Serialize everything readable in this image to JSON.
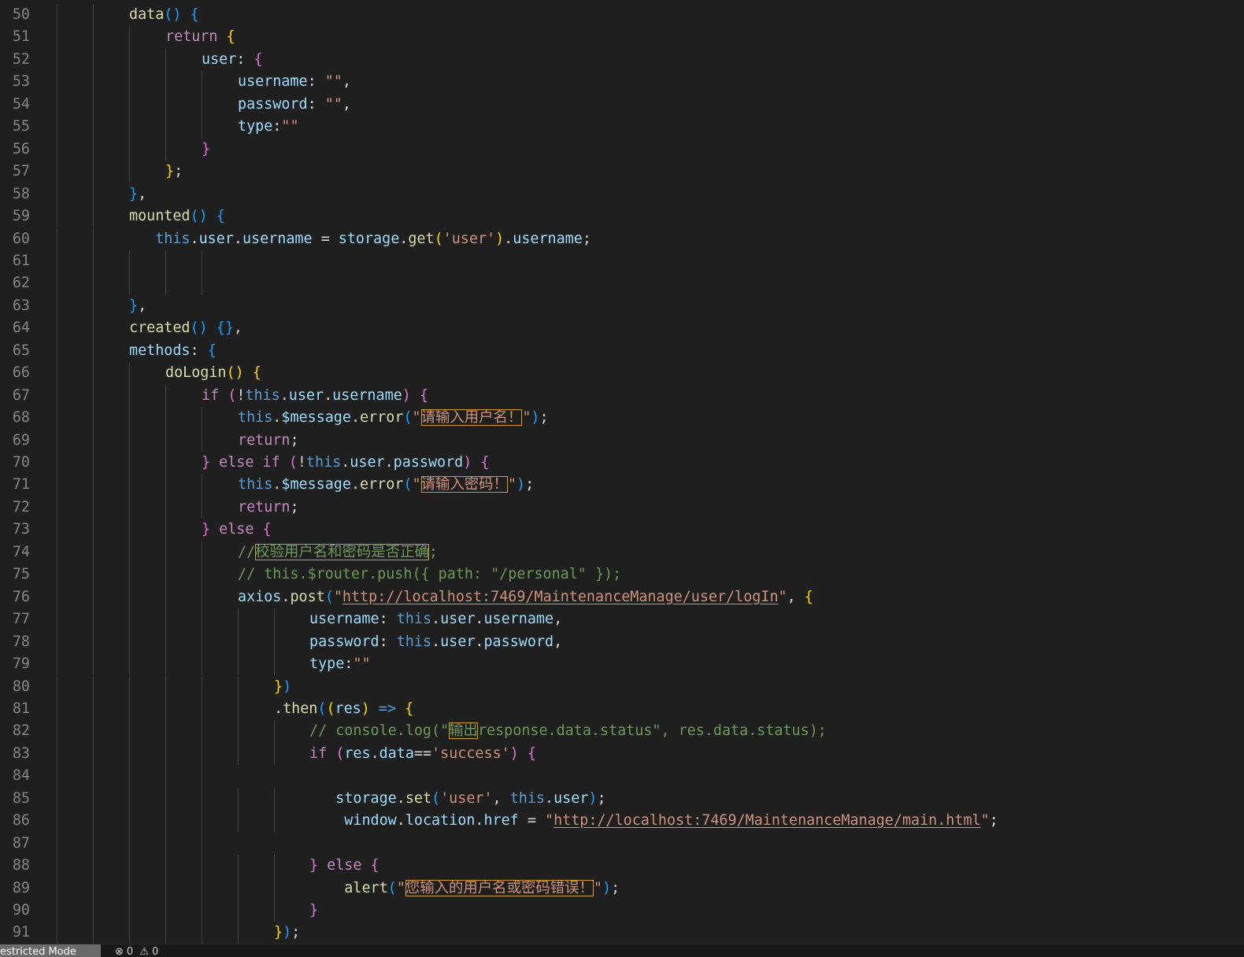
{
  "editor": {
    "lines": [
      {
        "n": "50",
        "indent": 0,
        "tokens": [
          [
            "fn",
            "data"
          ],
          [
            "b3",
            "()"
          ],
          [
            "pu",
            " "
          ],
          [
            "b3",
            "{"
          ]
        ]
      },
      {
        "n": "51",
        "indent": 1,
        "tokens": [
          [
            "kw",
            "return"
          ],
          [
            "pu",
            " "
          ],
          [
            "b1",
            "{"
          ]
        ]
      },
      {
        "n": "52",
        "indent": 2,
        "tokens": [
          [
            "pr",
            "user"
          ],
          [
            "pu",
            ": "
          ],
          [
            "b2",
            "{"
          ]
        ]
      },
      {
        "n": "53",
        "indent": 3,
        "tokens": [
          [
            "pr",
            "username"
          ],
          [
            "pu",
            ": "
          ],
          [
            "st",
            "\"\""
          ],
          [
            "pu",
            ","
          ]
        ]
      },
      {
        "n": "54",
        "indent": 3,
        "tokens": [
          [
            "pr",
            "password"
          ],
          [
            "pu",
            ": "
          ],
          [
            "st",
            "\"\""
          ],
          [
            "pu",
            ","
          ]
        ]
      },
      {
        "n": "55",
        "indent": 3,
        "tokens": [
          [
            "pr",
            "type"
          ],
          [
            "pu",
            ":"
          ],
          [
            "st",
            "\"\""
          ]
        ]
      },
      {
        "n": "56",
        "indent": 2,
        "tokens": [
          [
            "b2",
            "}"
          ]
        ]
      },
      {
        "n": "57",
        "indent": 1,
        "tokens": [
          [
            "b1",
            "}"
          ],
          [
            "pu",
            ";"
          ]
        ]
      },
      {
        "n": "58",
        "indent": 0,
        "tokens": [
          [
            "b3",
            "}"
          ],
          [
            "pu",
            ","
          ]
        ]
      },
      {
        "n": "59",
        "indent": 0,
        "tokens": [
          [
            "fn",
            "mounted"
          ],
          [
            "b3",
            "()"
          ],
          [
            "pu",
            " "
          ],
          [
            "b3",
            "{"
          ]
        ]
      },
      {
        "n": "60",
        "indent": 0,
        "tokens": [
          [
            "pu",
            "   "
          ],
          [
            "k1",
            "this"
          ],
          [
            "pu",
            "."
          ],
          [
            "pr",
            "user"
          ],
          [
            "pu",
            "."
          ],
          [
            "pr",
            "username"
          ],
          [
            "pu",
            " = "
          ],
          [
            "pr",
            "storage"
          ],
          [
            "pu",
            "."
          ],
          [
            "fn",
            "get"
          ],
          [
            "b1",
            "("
          ],
          [
            "st",
            "'user'"
          ],
          [
            "b1",
            ")"
          ],
          [
            "pu",
            "."
          ],
          [
            "pr",
            "username"
          ],
          [
            "pu",
            ";"
          ]
        ]
      },
      {
        "n": "61",
        "indent": 0,
        "tokens": []
      },
      {
        "n": "62",
        "indent": 0,
        "tokens": []
      },
      {
        "n": "63",
        "indent": 0,
        "tokens": [
          [
            "b3",
            "}"
          ],
          [
            "pu",
            ","
          ]
        ]
      },
      {
        "n": "64",
        "indent": 0,
        "tokens": [
          [
            "fn",
            "created"
          ],
          [
            "b3",
            "()"
          ],
          [
            "pu",
            " "
          ],
          [
            "b3",
            "{}"
          ],
          [
            "pu",
            ","
          ]
        ]
      },
      {
        "n": "65",
        "indent": 0,
        "tokens": [
          [
            "pr",
            "methods"
          ],
          [
            "pu",
            ": "
          ],
          [
            "b3",
            "{"
          ]
        ]
      },
      {
        "n": "66",
        "indent": 1,
        "tokens": [
          [
            "fn",
            "doLogin"
          ],
          [
            "b1",
            "()"
          ],
          [
            "pu",
            " "
          ],
          [
            "b1",
            "{"
          ]
        ]
      },
      {
        "n": "67",
        "indent": 2,
        "tokens": [
          [
            "kw",
            "if"
          ],
          [
            "pu",
            " "
          ],
          [
            "b2",
            "("
          ],
          [
            "pu",
            "!"
          ],
          [
            "k1",
            "this"
          ],
          [
            "pu",
            "."
          ],
          [
            "pr",
            "user"
          ],
          [
            "pu",
            "."
          ],
          [
            "pr",
            "username"
          ],
          [
            "b2",
            ")"
          ],
          [
            "pu",
            " "
          ],
          [
            "b2",
            "{"
          ]
        ]
      },
      {
        "n": "68",
        "indent": 3,
        "tokens": [
          [
            "k1",
            "this"
          ],
          [
            "pu",
            "."
          ],
          [
            "pr",
            "$message"
          ],
          [
            "pu",
            "."
          ],
          [
            "fn",
            "error"
          ],
          [
            "b3",
            "("
          ],
          [
            "st",
            "\""
          ],
          [
            "st hl",
            "请输入用户名！"
          ],
          [
            "st",
            "\""
          ],
          [
            "b3",
            ")"
          ],
          [
            "pu",
            ";"
          ]
        ]
      },
      {
        "n": "69",
        "indent": 3,
        "tokens": [
          [
            "kw",
            "return"
          ],
          [
            "pu",
            ";"
          ]
        ]
      },
      {
        "n": "70",
        "indent": 2,
        "tokens": [
          [
            "b2",
            "}"
          ],
          [
            "pu",
            " "
          ],
          [
            "kw",
            "else"
          ],
          [
            "pu",
            " "
          ],
          [
            "kw",
            "if"
          ],
          [
            "pu",
            " "
          ],
          [
            "b2",
            "("
          ],
          [
            "pu",
            "!"
          ],
          [
            "k1",
            "this"
          ],
          [
            "pu",
            "."
          ],
          [
            "pr",
            "user"
          ],
          [
            "pu",
            "."
          ],
          [
            "pr",
            "password"
          ],
          [
            "b2",
            ")"
          ],
          [
            "pu",
            " "
          ],
          [
            "b2",
            "{"
          ]
        ]
      },
      {
        "n": "71",
        "indent": 3,
        "tokens": [
          [
            "k1",
            "this"
          ],
          [
            "pu",
            "."
          ],
          [
            "pr",
            "$message"
          ],
          [
            "pu",
            "."
          ],
          [
            "fn",
            "error"
          ],
          [
            "b3",
            "("
          ],
          [
            "st",
            "\""
          ],
          [
            "st hl",
            "请输入密码！"
          ],
          [
            "st",
            "\""
          ],
          [
            "b3",
            ")"
          ],
          [
            "pu",
            ";"
          ]
        ]
      },
      {
        "n": "72",
        "indent": 3,
        "tokens": [
          [
            "kw",
            "return"
          ],
          [
            "pu",
            ";"
          ]
        ]
      },
      {
        "n": "73",
        "indent": 2,
        "tokens": [
          [
            "b2",
            "}"
          ],
          [
            "pu",
            " "
          ],
          [
            "kw",
            "else"
          ],
          [
            "pu",
            " "
          ],
          [
            "b2",
            "{"
          ]
        ]
      },
      {
        "n": "74",
        "indent": 3,
        "tokens": [
          [
            "cm",
            "//"
          ],
          [
            "cm hl",
            "校验用户名和密码是否正确"
          ],
          [
            "cm",
            ";"
          ]
        ]
      },
      {
        "n": "75",
        "indent": 3,
        "tokens": [
          [
            "cm",
            "// this.$router.push({ path: \"/personal\" });"
          ]
        ]
      },
      {
        "n": "76",
        "indent": 3,
        "tokens": [
          [
            "pr",
            "axios"
          ],
          [
            "pu",
            "."
          ],
          [
            "fn",
            "post"
          ],
          [
            "b3",
            "("
          ],
          [
            "st",
            "\""
          ],
          [
            "st url",
            "http://localhost:7469/MaintenanceManage/user/logIn"
          ],
          [
            "st",
            "\""
          ],
          [
            "pu",
            ", "
          ],
          [
            "b1",
            "{"
          ]
        ]
      },
      {
        "n": "77",
        "indent": 5,
        "tokens": [
          [
            "pr",
            "username"
          ],
          [
            "pu",
            ": "
          ],
          [
            "k1",
            "this"
          ],
          [
            "pu",
            "."
          ],
          [
            "pr",
            "user"
          ],
          [
            "pu",
            "."
          ],
          [
            "pr",
            "username"
          ],
          [
            "pu",
            ","
          ]
        ]
      },
      {
        "n": "78",
        "indent": 5,
        "tokens": [
          [
            "pr",
            "password"
          ],
          [
            "pu",
            ": "
          ],
          [
            "k1",
            "this"
          ],
          [
            "pu",
            "."
          ],
          [
            "pr",
            "user"
          ],
          [
            "pu",
            "."
          ],
          [
            "pr",
            "password"
          ],
          [
            "pu",
            ","
          ]
        ]
      },
      {
        "n": "79",
        "indent": 5,
        "tokens": [
          [
            "pr",
            "type"
          ],
          [
            "pu",
            ":"
          ],
          [
            "st",
            "\"\""
          ]
        ]
      },
      {
        "n": "80",
        "indent": 4,
        "tokens": [
          [
            "b1",
            "}"
          ],
          [
            "b3",
            ")"
          ]
        ]
      },
      {
        "n": "81",
        "indent": 4,
        "tokens": [
          [
            "pu",
            "."
          ],
          [
            "fn",
            "then"
          ],
          [
            "b3",
            "("
          ],
          [
            "b1",
            "("
          ],
          [
            "pr",
            "res"
          ],
          [
            "b1",
            ")"
          ],
          [
            "pu",
            " "
          ],
          [
            "k1",
            "=>"
          ],
          [
            "pu",
            " "
          ],
          [
            "b1",
            "{"
          ]
        ]
      },
      {
        "n": "82",
        "indent": 5,
        "tokens": [
          [
            "cm",
            "// console.log(\""
          ],
          [
            "cm hl",
            "输出"
          ],
          [
            "cm",
            "response.data.status\", res.data.status);"
          ]
        ]
      },
      {
        "n": "83",
        "indent": 5,
        "tokens": [
          [
            "kw",
            "if"
          ],
          [
            "pu",
            " "
          ],
          [
            "b2",
            "("
          ],
          [
            "pr",
            "res"
          ],
          [
            "pu",
            "."
          ],
          [
            "pr",
            "data"
          ],
          [
            "pu",
            "=="
          ],
          [
            "st",
            "'success'"
          ],
          [
            "b2",
            ")"
          ],
          [
            "pu",
            " "
          ],
          [
            "b2",
            "{"
          ]
        ]
      },
      {
        "n": "84",
        "indent": 0,
        "tokens": []
      },
      {
        "n": "85",
        "indent": 5,
        "tokens": [
          [
            "pu",
            "   "
          ],
          [
            "pr",
            "storage"
          ],
          [
            "pu",
            "."
          ],
          [
            "fn",
            "set"
          ],
          [
            "b3",
            "("
          ],
          [
            "st",
            "'user'"
          ],
          [
            "pu",
            ", "
          ],
          [
            "k1",
            "this"
          ],
          [
            "pu",
            "."
          ],
          [
            "pr",
            "user"
          ],
          [
            "b3",
            ")"
          ],
          [
            "pu",
            ";"
          ]
        ]
      },
      {
        "n": "86",
        "indent": 5,
        "tokens": [
          [
            "pu",
            "    "
          ],
          [
            "pr",
            "window"
          ],
          [
            "pu",
            "."
          ],
          [
            "pr",
            "location"
          ],
          [
            "pu",
            "."
          ],
          [
            "pr",
            "href"
          ],
          [
            "pu",
            " = "
          ],
          [
            "st",
            "\""
          ],
          [
            "st url",
            "http://localhost:7469/MaintenanceManage/main.html"
          ],
          [
            "st",
            "\""
          ],
          [
            "pu",
            ";"
          ]
        ]
      },
      {
        "n": "87",
        "indent": 0,
        "tokens": []
      },
      {
        "n": "88",
        "indent": 5,
        "tokens": [
          [
            "b2",
            "}"
          ],
          [
            "pu",
            " "
          ],
          [
            "kw",
            "else"
          ],
          [
            "pu",
            " "
          ],
          [
            "b2",
            "{"
          ]
        ]
      },
      {
        "n": "89",
        "indent": 5,
        "tokens": [
          [
            "pu",
            "    "
          ],
          [
            "fn",
            "alert"
          ],
          [
            "b3",
            "("
          ],
          [
            "st",
            "\""
          ],
          [
            "st hl",
            "您输入的用户名或密码错误！"
          ],
          [
            "st",
            "\""
          ],
          [
            "b3",
            ")"
          ],
          [
            "pu",
            ";"
          ]
        ]
      },
      {
        "n": "90",
        "indent": 5,
        "tokens": [
          [
            "b2",
            "}"
          ]
        ]
      },
      {
        "n": "91",
        "indent": 4,
        "tokens": [
          [
            "b1",
            "}"
          ],
          [
            "b3",
            ")"
          ],
          [
            "pu",
            ";"
          ]
        ]
      }
    ]
  },
  "statusbar": {
    "restricted_label": "estricted Mode",
    "errors_icon": "error-circle-icon",
    "errors_count": "0",
    "warnings_icon": "warning-triangle-icon",
    "warnings_count": "0"
  }
}
